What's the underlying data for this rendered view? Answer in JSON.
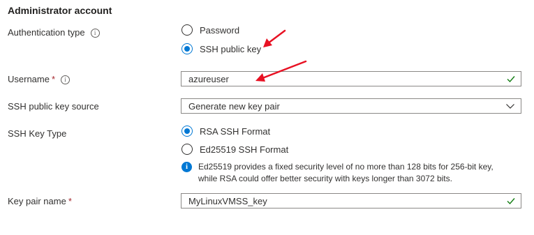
{
  "section_title": "Administrator account",
  "auth": {
    "label": "Authentication type",
    "info": "i",
    "options": [
      {
        "label": "Password",
        "checked": false
      },
      {
        "label": "SSH public key",
        "checked": true
      }
    ]
  },
  "username": {
    "label": "Username",
    "required": "*",
    "info": "i",
    "value": "azureuser",
    "valid": true
  },
  "key_source": {
    "label": "SSH public key source",
    "value": "Generate new key pair"
  },
  "key_type": {
    "label": "SSH Key Type",
    "options": [
      {
        "label": "RSA SSH Format",
        "checked": true
      },
      {
        "label": "Ed25519 SSH Format",
        "checked": false
      }
    ],
    "info_icon": "i",
    "info_line1": "Ed25519 provides a fixed security level of no more than 128 bits for 256-bit key,",
    "info_line2": "while RSA could offer better security with keys longer than 3072 bits."
  },
  "key_pair": {
    "label": "Key pair name",
    "required": "*",
    "value": "MyLinuxVMSS_key",
    "valid": true
  },
  "colors": {
    "accent": "#0078d4",
    "valid_check": "#107c10",
    "required": "#a4262c",
    "annotation_arrow": "#e81123"
  }
}
